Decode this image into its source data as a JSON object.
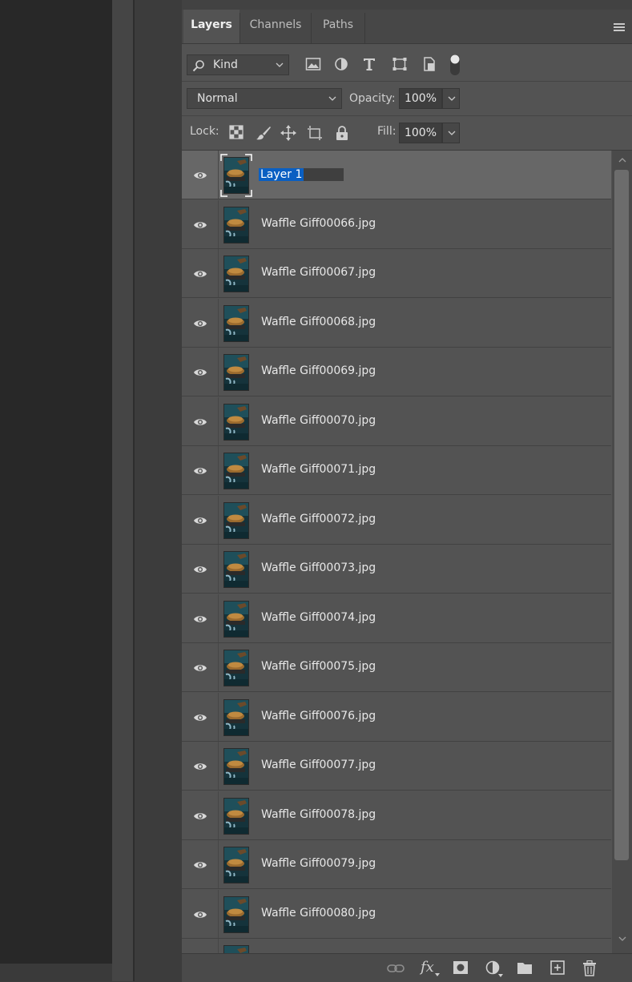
{
  "tabs": [
    {
      "label": "Layers",
      "active": true
    },
    {
      "label": "Channels",
      "active": false
    },
    {
      "label": "Paths",
      "active": false
    }
  ],
  "filter": {
    "kind_label": "Kind"
  },
  "blend": {
    "mode": "Normal",
    "opacity_label": "Opacity:",
    "opacity_value": "100%"
  },
  "lock": {
    "label": "Lock:",
    "fill_label": "Fill:",
    "fill_value": "100%"
  },
  "layers": [
    {
      "name": "Layer 1",
      "selected": true,
      "editing": true,
      "visible": true
    },
    {
      "name": "Waffle Giff00066.jpg",
      "visible": true
    },
    {
      "name": "Waffle Giff00067.jpg",
      "visible": true
    },
    {
      "name": "Waffle Giff00068.jpg",
      "visible": true
    },
    {
      "name": "Waffle Giff00069.jpg",
      "visible": true
    },
    {
      "name": "Waffle Giff00070.jpg",
      "visible": true
    },
    {
      "name": "Waffle Giff00071.jpg",
      "visible": true
    },
    {
      "name": "Waffle Giff00072.jpg",
      "visible": true
    },
    {
      "name": "Waffle Giff00073.jpg",
      "visible": true
    },
    {
      "name": "Waffle Giff00074.jpg",
      "visible": true
    },
    {
      "name": "Waffle Giff00075.jpg",
      "visible": true
    },
    {
      "name": "Waffle Giff00076.jpg",
      "visible": true
    },
    {
      "name": "Waffle Giff00077.jpg",
      "visible": true
    },
    {
      "name": "Waffle Giff00078.jpg",
      "visible": true
    },
    {
      "name": "Waffle Giff00079.jpg",
      "visible": true
    },
    {
      "name": "Waffle Giff00080.jpg",
      "visible": true
    },
    {
      "name": "",
      "visible": false
    }
  ],
  "bottom_bar": {
    "fx_label": "fx"
  },
  "colors": {
    "panel_bg": "#535353",
    "selected_row": "#676767",
    "selection_highlight": "#0a5fc2",
    "thumb_teal": "#1f4f5a"
  }
}
